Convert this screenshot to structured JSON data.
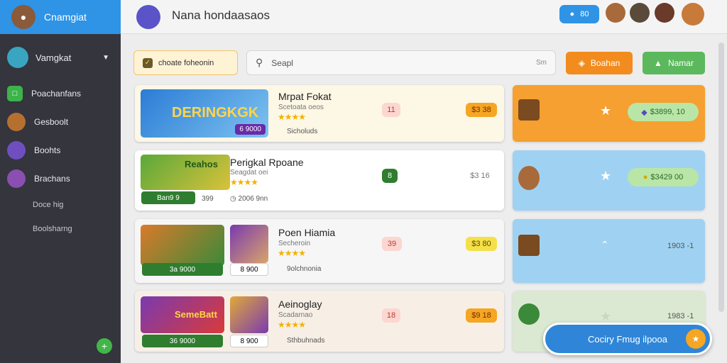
{
  "sidebar": {
    "brand": "Cnamgiat",
    "user": "Vamgkat",
    "items": [
      {
        "label": "Poachanfans"
      },
      {
        "label": "Gesboolt"
      },
      {
        "label": "Boohts"
      },
      {
        "label": "Brachans"
      }
    ],
    "sub_items": [
      {
        "label": "Doce hig"
      },
      {
        "label": "Boolsharng"
      }
    ]
  },
  "topbar": {
    "title": "Nana hondaasaos",
    "badge": "80"
  },
  "toolbar": {
    "filter_label": "choate foheonin",
    "search_placeholder": "Seapl",
    "search_hint": "Sm",
    "btn1": "Boahan",
    "btn2": "Namar"
  },
  "games": [
    {
      "title": "Mrpat Fokat",
      "subtitle": "Scetoata oeos",
      "thumb_text": "DERINGKGK",
      "thumb_price": "6 9000",
      "meta": "Sicholuds",
      "badge1": "11",
      "badge2": "$3 38"
    },
    {
      "title": "Perigkal Rpoane",
      "subtitle": "Seagdat oei",
      "thumb_text": "Reahos",
      "thumb_price": "Ban9 9",
      "price2": "399",
      "meta": "2006 9nn",
      "badge1": "8",
      "badge2": "$3 16"
    },
    {
      "title": "Poen Hiamia",
      "subtitle": "Secheroin",
      "price1": "3a 9000",
      "price2": "8 900",
      "meta": "9olchnonia",
      "badge1": "39",
      "badge2": "$3 80"
    },
    {
      "title": "Aeinoglay",
      "subtitle": "Scadarnao",
      "thumb_text": "SemeBatt",
      "price1": "36 9000",
      "price2": "8 900",
      "meta": "Sthbuhnads",
      "badge1": "18",
      "badge2": "$9 18"
    }
  ],
  "offers": [
    {
      "pill": "$3899, 10"
    },
    {
      "pill": "$3429 00"
    },
    {
      "text": "1903 -1"
    },
    {
      "text": "1983 -1"
    }
  ],
  "cta": "Cociry Fmug ilpooa",
  "colors": {
    "accent": "#2f93e6",
    "orange": "#f5a623",
    "green": "#5cb85c"
  }
}
